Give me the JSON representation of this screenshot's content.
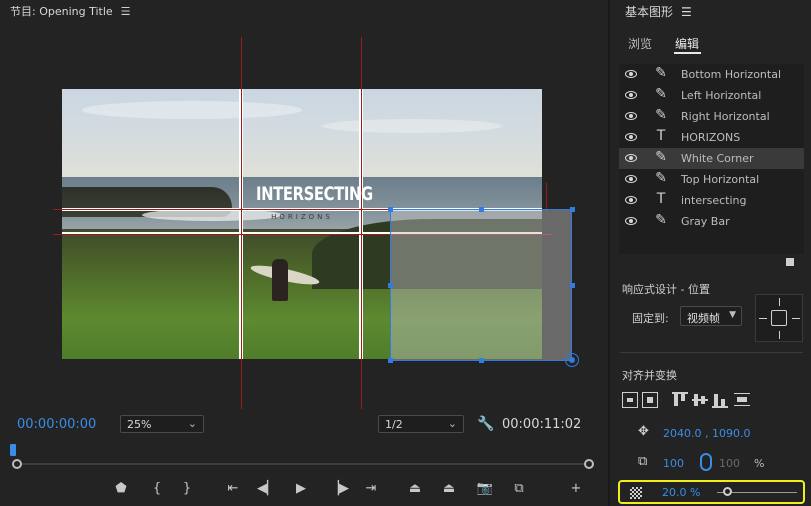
{
  "monitor": {
    "title": "节目: Opening Title",
    "menu_icon": "hamburger-menu-icon",
    "overlay": {
      "title_main": "INTERSECTING",
      "title_sub": "HORIZONS"
    },
    "timecode_current": "00:00:00:00",
    "timecode_duration": "00:00:11:02",
    "zoom_select": "25%",
    "resolution_select": "1/2",
    "accent_color": "#3a8de6",
    "guide_color": "#9a1b1b",
    "transport": {
      "buttons": [
        {
          "name": "add-marker-button",
          "glyph": "⬟"
        },
        {
          "name": "mark-in-button",
          "glyph": "{"
        },
        {
          "name": "mark-out-button",
          "glyph": "}"
        },
        {
          "name": "go-to-in-button",
          "glyph": "⇤"
        },
        {
          "name": "step-back-button",
          "glyph": "◀▏"
        },
        {
          "name": "play-button",
          "glyph": "▶"
        },
        {
          "name": "step-forward-button",
          "glyph": "▕▶"
        },
        {
          "name": "go-to-out-button",
          "glyph": "⇥"
        },
        {
          "name": "lift-button",
          "glyph": "⏏"
        },
        {
          "name": "extract-button",
          "glyph": "⏏"
        },
        {
          "name": "export-frame-button",
          "glyph": "📷"
        },
        {
          "name": "compare-view-button",
          "glyph": "⧉"
        },
        {
          "name": "button-editor-button",
          "glyph": "+"
        }
      ]
    }
  },
  "panel": {
    "title": "基本图形",
    "tabs": [
      {
        "label": "浏览",
        "active": false
      },
      {
        "label": "编辑",
        "active": true
      }
    ],
    "layers": [
      {
        "name": "Bottom Horizontal",
        "type": "pen-icon",
        "glyph": "✎",
        "selected": false
      },
      {
        "name": "Left Horizontal",
        "type": "pen-icon",
        "glyph": "✎",
        "selected": false
      },
      {
        "name": "Right Horizontal",
        "type": "pen-icon",
        "glyph": "✎",
        "selected": false
      },
      {
        "name": "HORIZONS",
        "type": "text-icon",
        "glyph": "T",
        "selected": false
      },
      {
        "name": "White Corner",
        "type": "pen-icon",
        "glyph": "✎",
        "selected": true
      },
      {
        "name": "Top Horizontal",
        "type": "pen-icon",
        "glyph": "✎",
        "selected": false
      },
      {
        "name": "intersecting",
        "type": "text-icon",
        "glyph": "T",
        "selected": false
      },
      {
        "name": "Gray Bar",
        "type": "pen-icon",
        "glyph": "✎",
        "selected": false
      }
    ],
    "responsive_section": "响应式设计 - 位置",
    "pin_to_label": "固定到:",
    "pin_to_value": "视频帧",
    "align_section": "对齐并变换",
    "position_x": "2040.0 ,",
    "position_y": "1090.0",
    "scale_value": "100",
    "scale_linked_value": "100",
    "scale_unit": "%",
    "opacity_value": "20.0 %",
    "opacity_level": 0.2,
    "highlight_color": "#f1ee1c"
  }
}
